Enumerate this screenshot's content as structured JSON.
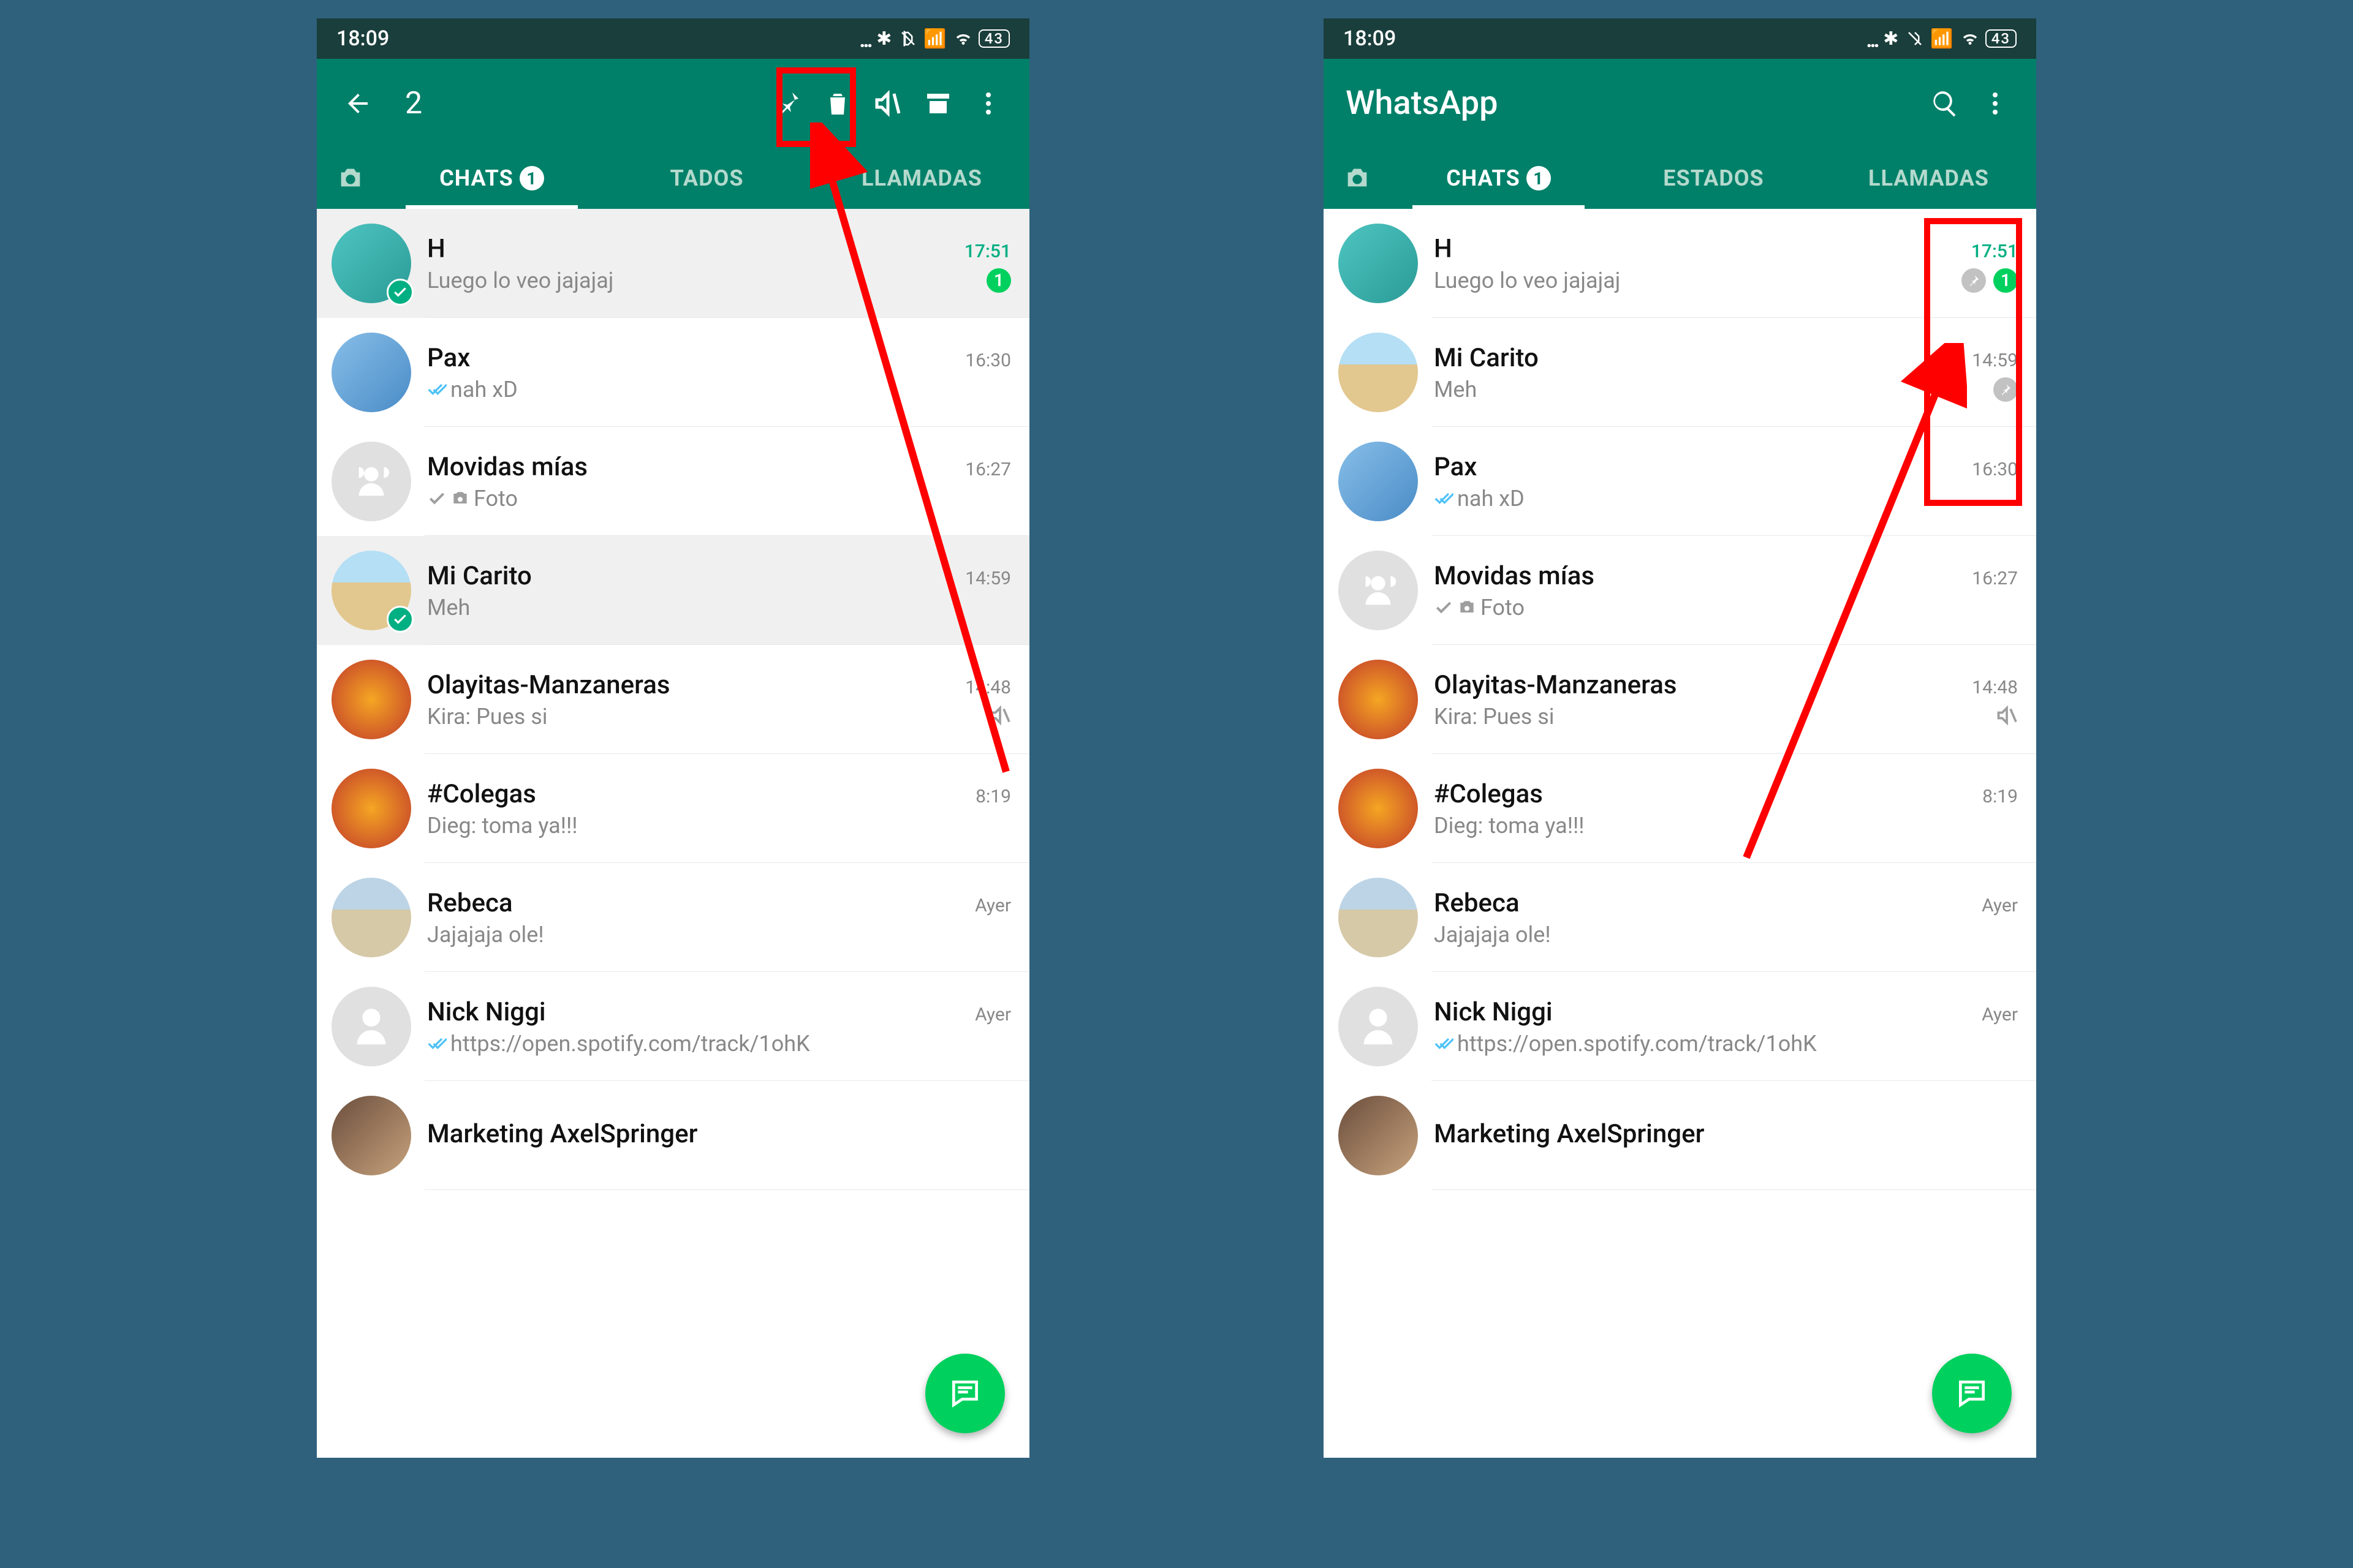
{
  "status_time": "18:09",
  "battery": "43",
  "left": {
    "selection_count": "2",
    "tabs": {
      "chats": "CHATS",
      "chats_badge": "1",
      "estados": "TADOS",
      "llamadas": "LLAMADAS"
    },
    "chats": [
      {
        "name": "H",
        "preview": "Luego lo veo jajajaj",
        "time": "17:51",
        "unread": "1",
        "selected": true,
        "avatar": "teal"
      },
      {
        "name": "Pax",
        "preview": "nah xD",
        "time": "16:30",
        "ticks": "blue",
        "avatar": "sky"
      },
      {
        "name": "Movidas mías",
        "preview": "Foto",
        "time": "16:27",
        "ticks": "grey",
        "photo": true,
        "avatar": "grp",
        "group": true
      },
      {
        "name": "Mi Carito",
        "preview": "Meh",
        "time": "14:59",
        "selected": true,
        "avatar": "beach"
      },
      {
        "name": "Olayitas-Manzaneras",
        "preview": "Kira: Pues si",
        "time": "14:48",
        "muted": true,
        "avatar": "food"
      },
      {
        "name": "#Colegas",
        "preview": "Dieg: toma ya!!!",
        "time": "8:19",
        "avatar": "food"
      },
      {
        "name": "Rebeca",
        "preview": "Jajajaja ole!",
        "time": "Ayer",
        "avatar": "temple"
      },
      {
        "name": "Nick Niggi",
        "preview": "https://open.spotify.com/track/1ohK",
        "time": "Ayer",
        "ticks": "blue",
        "avatar": "grp"
      },
      {
        "name": "Marketing AxelSpringer",
        "preview": "",
        "time": "",
        "avatar": "people"
      }
    ]
  },
  "right": {
    "app_title": "WhatsApp",
    "tabs": {
      "chats": "CHATS",
      "chats_badge": "1",
      "estados": "ESTADOS",
      "llamadas": "LLAMADAS"
    },
    "chats": [
      {
        "name": "H",
        "preview": "Luego lo veo jajajaj",
        "time": "17:51",
        "unread": "1",
        "pinned": true,
        "avatar": "teal",
        "time_unread": true
      },
      {
        "name": "Mi Carito",
        "preview": "Meh",
        "time": "14:59",
        "pinned": true,
        "avatar": "beach"
      },
      {
        "name": "Pax",
        "preview": "nah xD",
        "time": "16:30",
        "ticks": "blue",
        "avatar": "sky"
      },
      {
        "name": "Movidas mías",
        "preview": "Foto",
        "time": "16:27",
        "ticks": "grey",
        "photo": true,
        "avatar": "grp",
        "group": true
      },
      {
        "name": "Olayitas-Manzaneras",
        "preview": "Kira: Pues si",
        "time": "14:48",
        "muted": true,
        "avatar": "food"
      },
      {
        "name": "#Colegas",
        "preview": "Dieg: toma ya!!!",
        "time": "8:19",
        "avatar": "food"
      },
      {
        "name": "Rebeca",
        "preview": "Jajajaja ole!",
        "time": "Ayer",
        "avatar": "temple"
      },
      {
        "name": "Nick Niggi",
        "preview": "https://open.spotify.com/track/1ohK",
        "time": "Ayer",
        "ticks": "blue",
        "avatar": "grp"
      },
      {
        "name": "Marketing AxelSpringer",
        "preview": "",
        "time": "",
        "avatar": "people"
      }
    ]
  }
}
